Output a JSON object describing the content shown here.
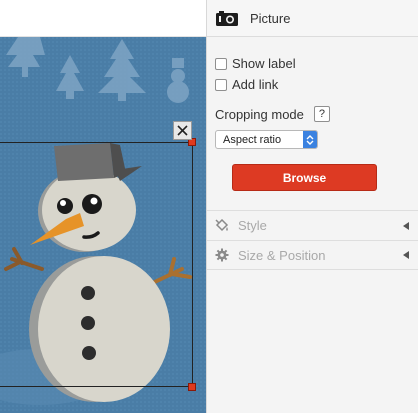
{
  "panel": {
    "title": "Picture",
    "title_icon": "camera-icon",
    "show_label": "Show label",
    "add_link": "Add link",
    "cropping_label": "Cropping mode",
    "help_label": "?",
    "cropping_value": "Aspect ratio",
    "browse_label": "Browse",
    "sections": [
      {
        "label": "Style",
        "icon": "paint-bucket-icon"
      },
      {
        "label": "Size & Position",
        "icon": "gear-icon"
      }
    ]
  },
  "colors": {
    "accent": "#dd3a23",
    "select_accent": "#3b82e0",
    "picture_background": "#4b7ea6"
  }
}
